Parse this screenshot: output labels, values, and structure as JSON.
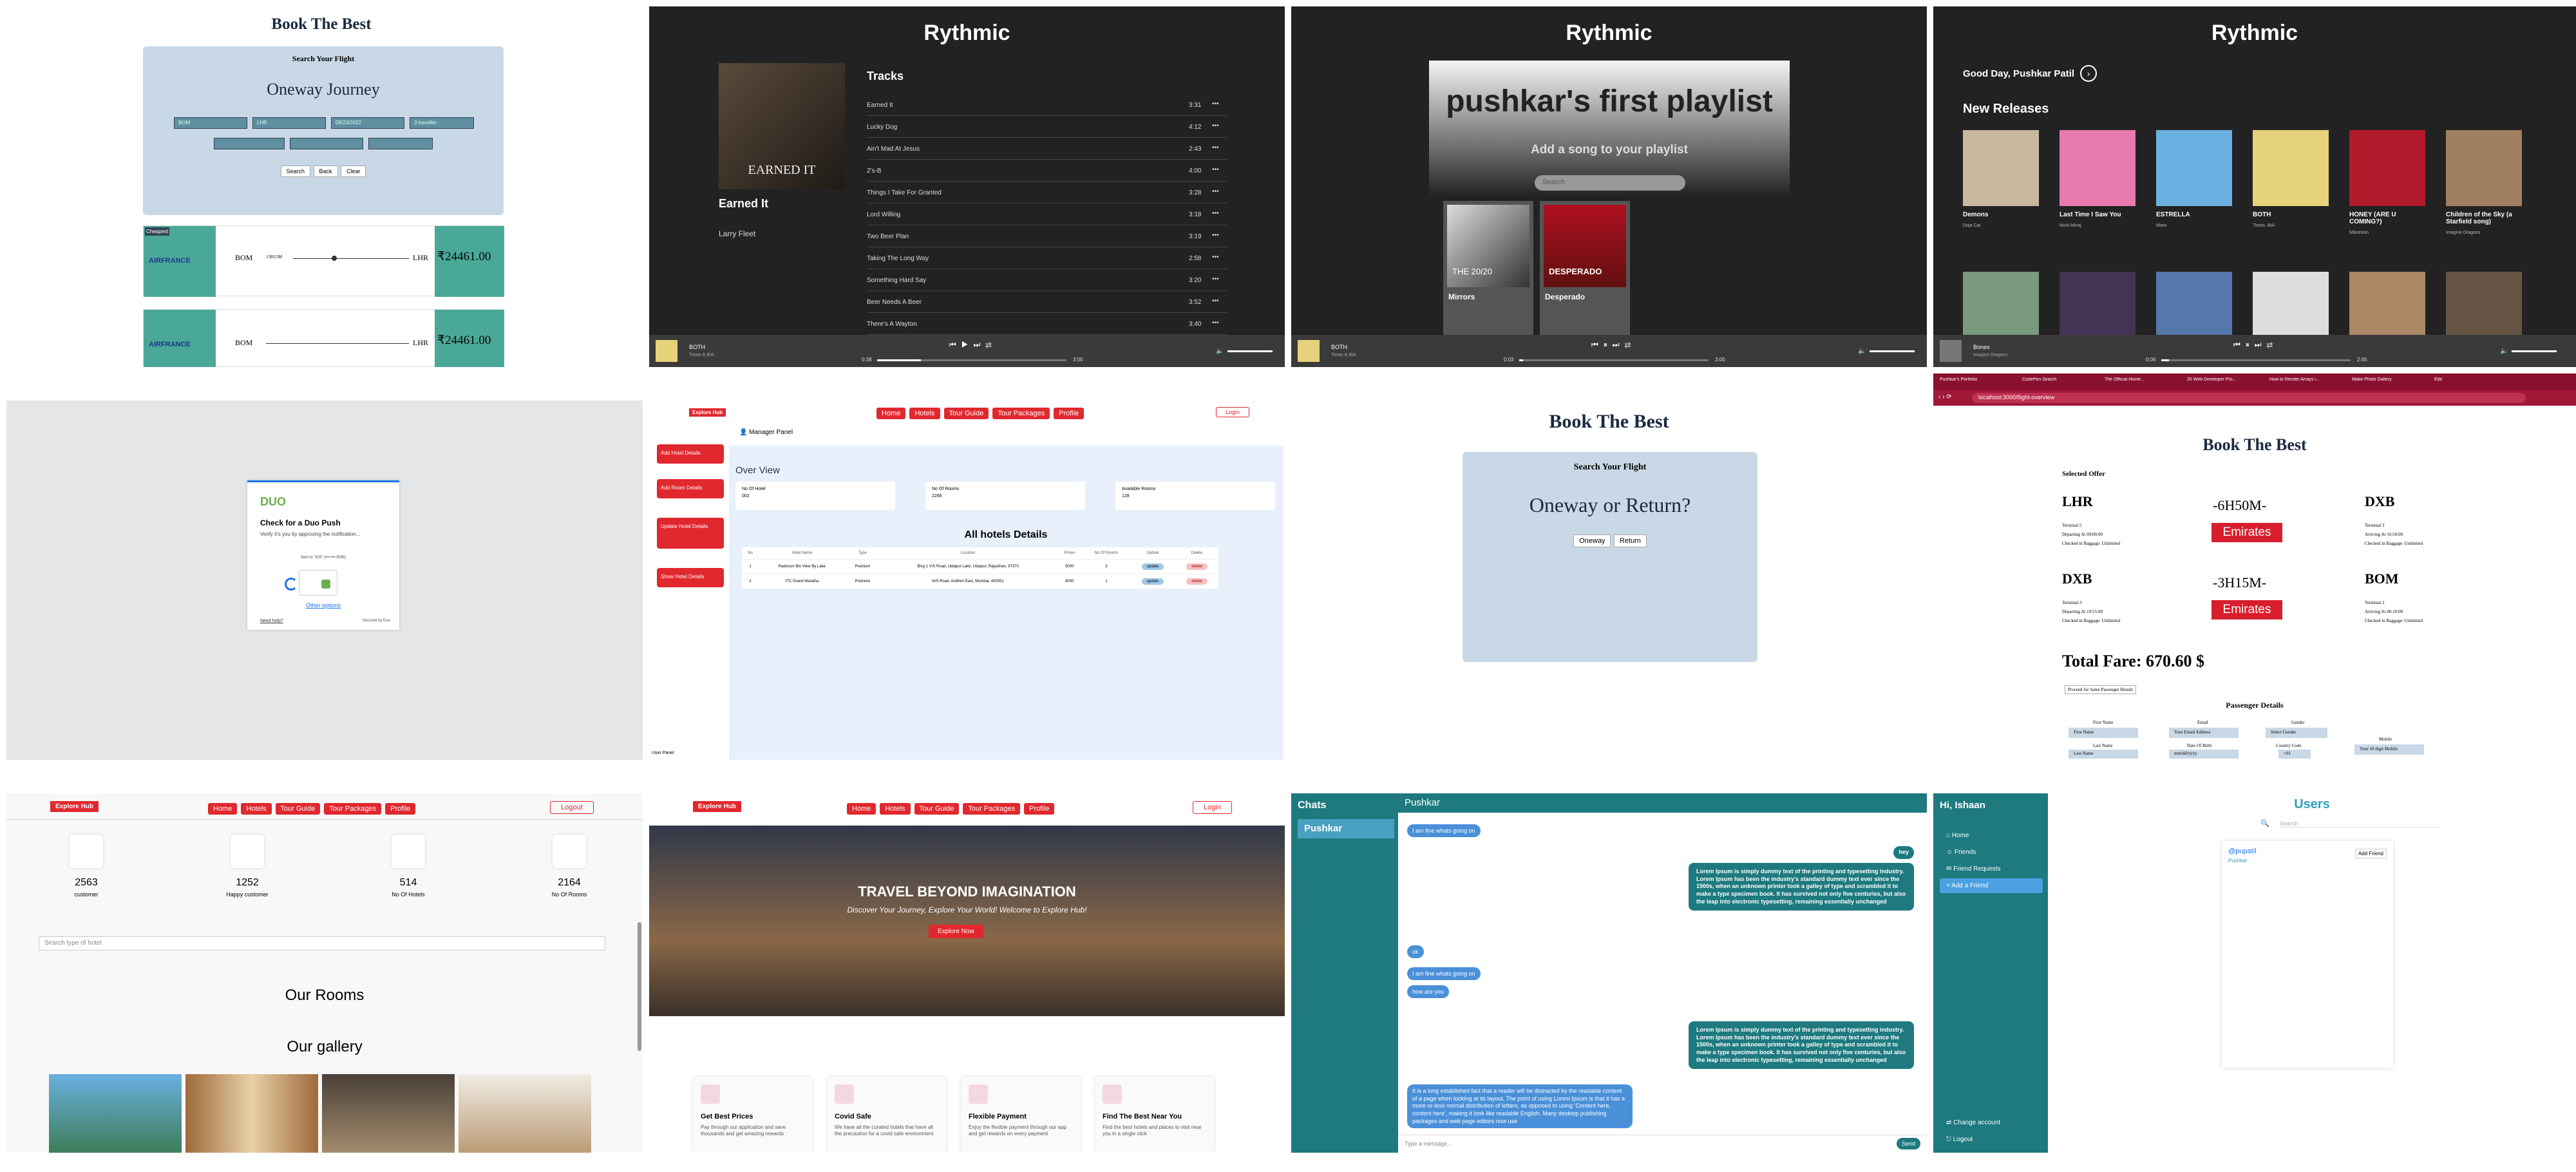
{
  "flight_search": {
    "title": "Book The Best",
    "subtitle": "Search Your Flight",
    "heading": "Oneway Journey",
    "from": "BOM",
    "to": "LHR",
    "date": "09/23/2022",
    "travellers": "3 traveller",
    "btn_search": "Search",
    "btn_back": "Back",
    "btn_clear": "Clear",
    "results": [
      {
        "tag": "Cheapest",
        "airline": "AIRFRANCE",
        "from": "BOM",
        "to": "LHR",
        "duration": "13H15M",
        "price": "₹24461.00"
      },
      {
        "airline": "AIRFRANCE",
        "from": "BOM",
        "to": "LHR",
        "price": "₹24461.00"
      }
    ]
  },
  "album": {
    "app": "Rythmic",
    "heading": "Tracks",
    "album_title": "Earned It",
    "artist": "Larry Fleet",
    "art_text": "EARNED IT",
    "tracks": [
      {
        "name": "Earned It",
        "time": "3:31"
      },
      {
        "name": "Lucky Dog",
        "time": "4:12"
      },
      {
        "name": "Ain't Mad At Jesus",
        "time": "2:43"
      },
      {
        "name": "2's-B",
        "time": "4:00"
      },
      {
        "name": "Things I Take For Granted",
        "time": "3:28"
      },
      {
        "name": "Lord Willing",
        "time": "3:18"
      },
      {
        "name": "Two Beer Plan",
        "time": "3:19"
      },
      {
        "name": "Taking The Long Way",
        "time": "2:58"
      },
      {
        "name": "Something Hard Say",
        "time": "3:20"
      },
      {
        "name": "Beer Needs A Beer",
        "time": "3:52"
      },
      {
        "name": "There's A Wayton",
        "time": "3:40"
      }
    ],
    "player": {
      "song": "BOTH",
      "sub": "Tiesto & BIA",
      "elapsed": "0:38",
      "total": "3:00"
    }
  },
  "playlist": {
    "app": "Rythmic",
    "title": "pushkar's first playlist",
    "cta": "Add a song to your playlist",
    "search_placeholder": "Search",
    "songs": [
      {
        "name": "Mirrors",
        "art": "THE 20/20"
      },
      {
        "name": "Desperado",
        "art": "DESPERADO"
      }
    ],
    "player": {
      "song": "BOTH",
      "sub": "Tiesto & BIA",
      "elapsed": "0:03",
      "total": "3:00"
    }
  },
  "home_music": {
    "app": "Rythmic",
    "greeting": "Good Day, Pushkar Patil",
    "section": "New Releases",
    "releases": [
      {
        "title": "Demons",
        "artist": "Doja Cat",
        "color": "#c9b8a0"
      },
      {
        "title": "Last Time I Saw You",
        "artist": "Nicki Minaj",
        "color": "#e87ab0"
      },
      {
        "title": "ESTRELLA",
        "artist": "Mora",
        "color": "#6ab0e0"
      },
      {
        "title": "BOTH",
        "artist": "Tiesto, BIA",
        "color": "#e6d27a"
      },
      {
        "title": "HONEY (ARE U COMING?)",
        "artist": "Måneskin",
        "color": "#b01a2a"
      },
      {
        "title": "Children of the Sky (a Starfield song)",
        "artist": "Imagine Dragons",
        "color": "#a08060"
      }
    ],
    "row2_colors": [
      "#7a9a80",
      "#443355",
      "#5577aa",
      "#dddddd",
      "#aa8866",
      "#665544"
    ],
    "player": {
      "song": "Bones",
      "sub": "Imagine Dragons",
      "elapsed": "0:06",
      "total": "2:45"
    }
  },
  "duo": {
    "brand": "DUO",
    "title": "Check for a Duo Push",
    "text": "Verify it's you by approving the notification...",
    "sent": "Sent to \"iOS\" (•••-•••-3545)",
    "link": "Other options",
    "help": "Need help?",
    "secured": "Secured by Duo"
  },
  "manager": {
    "logo": "Explore Hub",
    "nav": [
      "Home",
      "Hotels",
      "Tour Guide",
      "Tour Packages",
      "Profile"
    ],
    "login": "Login",
    "panel": "Manager Panel",
    "side": [
      "Add Hotel Details",
      "Add Room Details",
      "Update Hotel Details",
      "Show Hotel Details"
    ],
    "overview": "Over View",
    "cards": [
      {
        "label": "No Of Hotel",
        "value": "002"
      },
      {
        "label": "No Of Rooms",
        "value": "2266"
      },
      {
        "label": "Available Rooms",
        "value": "128"
      }
    ],
    "table_title": "All hotels Details",
    "headers": [
      "No",
      "Hotel Name",
      "Type",
      "Location",
      "Prices",
      "No Of Rooms",
      "Update",
      "Delete"
    ],
    "rows": [
      [
        "1",
        "Radisson Blu View By Lake",
        "Premium",
        "Blvg 1 V/S Road, Udaipur Lake, Udaipur, Rajasthan, 97370",
        "5000",
        "3",
        "update",
        "delete"
      ],
      [
        "2",
        "ITC Grand Maratha",
        "Premium",
        "N/S Road, Andheri East, Mumbai, 400051",
        "8000",
        "1",
        "update",
        "delete"
      ]
    ],
    "footer": "User Panel"
  },
  "oneway": {
    "title": "Book The Best",
    "subtitle": "Search Your Flight",
    "question": "Oneway or Return?",
    "btn1": "Oneway",
    "btn2": "Return"
  },
  "offer": {
    "tabs": [
      "Pushkar's Portfolio",
      "CodePen Search",
      "The Official Home...",
      "20 Web Developer Pro...",
      "How to Render Arrays i...",
      "Make Photo Gallery",
      "Edit"
    ],
    "url": "localhost:3000/flight-overview",
    "title": "Book The Best",
    "selected": "Selected Offer",
    "legs": [
      {
        "from": "LHR",
        "dep_terminal": "Terminal 5",
        "dep_time": "Departing At 09:00:00",
        "dep_checked": "Checked in Baggage: Unlimited",
        "duration": "-6H50M-",
        "airline": "Emirates",
        "to": "DXB",
        "arr_terminal": "Terminal 3",
        "arr_time": "Arriving At 16:50:00",
        "arr_checked": "Checked in Baggage: Unlimited"
      },
      {
        "from": "DXB",
        "dep_terminal": "Terminal 3",
        "dep_time": "Departing At 19:55:00",
        "dep_checked": "Checked in Baggage: Unlimited",
        "duration": "-3H15M-",
        "airline": "Emirates",
        "to": "BOM",
        "arr_terminal": "Terminal 2",
        "arr_time": "Arriving At 00:10:00",
        "arr_checked": "Checked in Baggage: Unlimited"
      }
    ],
    "fare": "Total Fare: 670.60 $",
    "proceed": "Proceed for Same Passenger Details",
    "pd": "Passenger Details",
    "fields": {
      "first_name": "First Name",
      "first_ph": "First Name",
      "email": "Email",
      "email_ph": "Your Email Address",
      "gender": "Gender",
      "gender_ph": "Select Gender",
      "mobile": "Mobile",
      "mobile_ph": "Your 10 digit Mobile",
      "last_name": "Last Name",
      "last_ph": "Last Name",
      "dob": "Date Of Birth",
      "dob_ph": "mm/dd/yyyy",
      "country": "Country Code",
      "country_ph": "+91"
    }
  },
  "explore_home": {
    "logo": "Explore Hub",
    "nav": [
      "Home",
      "Hotels",
      "Tour Guide",
      "Tour Packages",
      "Profile"
    ],
    "logout": "Logout",
    "stats": [
      {
        "value": "2563",
        "label": "customer"
      },
      {
        "value": "1252",
        "label": "Happy customer"
      },
      {
        "value": "514",
        "label": "No Of Hotels"
      },
      {
        "value": "2164",
        "label": "No Of Rooms"
      }
    ],
    "search_ph": "Search type of hotel",
    "rooms": "Our Rooms",
    "gallery": "Our gallery"
  },
  "explore_landing": {
    "logo": "Explore Hub",
    "nav": [
      "Home",
      "Hotels",
      "Tour Guide",
      "Tour Packages",
      "Profile"
    ],
    "login": "Login",
    "hero": "TRAVEL BEYOND IMAGINATION",
    "sub": "Discover Your Journey, Explore Your World! Welcome to Explore Hub!",
    "cta": "Explore Now",
    "features": [
      {
        "title": "Get Best Prices",
        "text": "Pay through our application and save thousands and get amazing rewards"
      },
      {
        "title": "Covid Safe",
        "text": "We have all the curated hotels that have all the precaution for a covid safe environment"
      },
      {
        "title": "Flexible Payment",
        "text": "Enjoy the flexible payment through our app and get rewards on every payment"
      },
      {
        "title": "Find The Best Near You",
        "text": "Find the best hotels and places to visit near you in a single click"
      }
    ]
  },
  "chat": {
    "sidebar_title": "Chats",
    "contact": "Pushkar",
    "header": "Pushkar",
    "messages": [
      "I am fine whats going on",
      "hey",
      "Lorem Ipsum is simply dummy text of the printing and typesetting industry. Lorem Ipsum has been the industry's standard dummy text ever since the 1500s, when an unknown printer took a galley of type and scrambled it to make a type specimen book. It has survived not only five centuries, but also the leap into electronic typesetting, remaining essentially unchanged",
      "ok",
      "I am fine whats going on",
      "how are you",
      "Lorem Ipsum is simply dummy text of the printing and typesetting industry. Lorem Ipsum has been the industry's standard dummy text ever since the 1500s, when an unknown printer took a galley of type and scrambled it to make a type specimen book. It has survived not only five centuries, but also the leap into electronic typesetting, remaining essentially unchanged",
      "It is a long established fact that a reader will be distracted by the readable content of a page when looking at its layout. The point of using Lorem Ipsum is that it has a more-or-less normal distribution of letters, as opposed to using 'Content here, content here', making it look like readable English. Many desktop publishing packages and web page editors now use"
    ],
    "input_ph": "Type a message...",
    "send": "Send"
  },
  "users": {
    "greeting": "Hi, Ishaan",
    "menu": [
      "Home",
      "Friends",
      "Friend Requests",
      "Add a Friend"
    ],
    "bottom": [
      "Change account",
      "Logout"
    ],
    "title": "Users",
    "search_ph": "Search",
    "user_handle": "@pupatil",
    "user_name": "Pushkar",
    "add": "Add Friend"
  }
}
